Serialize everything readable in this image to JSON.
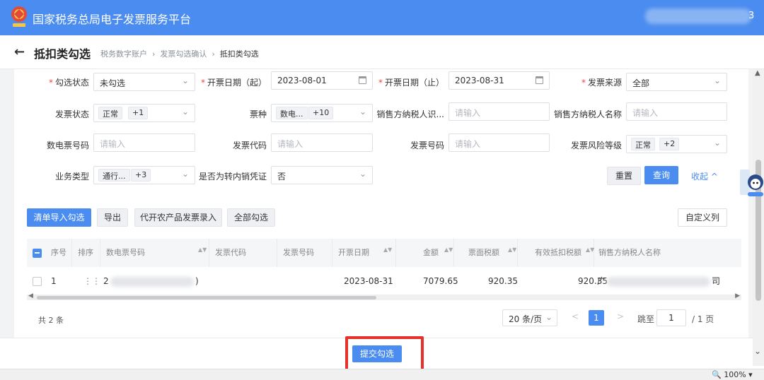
{
  "app": {
    "title": "国家税务总局电子发票服务平台",
    "user_tail": "3"
  },
  "page": {
    "title": "抵扣类勾选",
    "back": "←",
    "breadcrumbs": [
      "税务数字账户",
      "发票勾选确认",
      "抵扣类勾选"
    ],
    "separator": "›"
  },
  "filters": {
    "check_status": {
      "label": "勾选状态",
      "value": "未勾选"
    },
    "date_start": {
      "label": "开票日期（起）",
      "value": "2023-08-01"
    },
    "date_end": {
      "label": "开票日期（止）",
      "value": "2023-08-31"
    },
    "source": {
      "label": "发票来源",
      "value": "全部"
    },
    "invoice_status": {
      "label": "发票状态",
      "tag": "正常",
      "more": "+1"
    },
    "ticket_type": {
      "label": "票种",
      "tag": "数电...",
      "more": "+10"
    },
    "seller_tax_id": {
      "label": "销售方纳税人识...",
      "placeholder": "请输入"
    },
    "seller_name": {
      "label": "销售方纳税人名称",
      "placeholder": "请输入"
    },
    "digital_no": {
      "label": "数电票号码",
      "placeholder": "请输入"
    },
    "invoice_code": {
      "label": "发票代码",
      "placeholder": "请输入"
    },
    "invoice_no": {
      "label": "发票号码",
      "placeholder": "请输入"
    },
    "risk_level": {
      "label": "发票风险等级",
      "tag": "正常",
      "more": "+2"
    },
    "business_type": {
      "label": "业务类型",
      "tag": "通行...",
      "more": "+3"
    },
    "transfer": {
      "label": "是否为转内销凭证",
      "value": "否"
    },
    "required_mark": "*"
  },
  "actions": {
    "reset": "重置",
    "query": "查询",
    "collapse": "收起",
    "collapse_icon": "^"
  },
  "toolbar": {
    "import": "清单导入勾选",
    "export": "导出",
    "agri": "代开农产品发票录入",
    "select_all": "全部勾选",
    "custom_cols": "自定义列"
  },
  "table": {
    "headers": [
      "序号",
      "排序",
      "数电票号码",
      "发票代码",
      "发票号码",
      "开票日期",
      "金额",
      "票面税额",
      "有效抵扣税额",
      "销售方纳税人名称"
    ],
    "sort_icon": "▲▼",
    "rows": [
      {
        "index": "1",
        "drag": "⋮⋮",
        "digital_no_prefix": "2",
        "digital_no_suffix": ")",
        "date": "2023-08-31",
        "amount": "7079.65",
        "tax": "920.35",
        "valid_tax": "920.35",
        "seller_prefix": "广",
        "seller_suffix": "司"
      }
    ]
  },
  "pagination": {
    "total": "共 2 条",
    "page_size": "20 条/页",
    "prev": "<",
    "next": ">",
    "current": "1",
    "jump_label": "跳至",
    "jump_value": "1",
    "total_pages": "/ 1 页"
  },
  "footer": {
    "submit": "提交勾选"
  },
  "status": {
    "zoom": "100%"
  },
  "colors": {
    "primary": "#4a8cef",
    "highlight": "#e8302a"
  }
}
